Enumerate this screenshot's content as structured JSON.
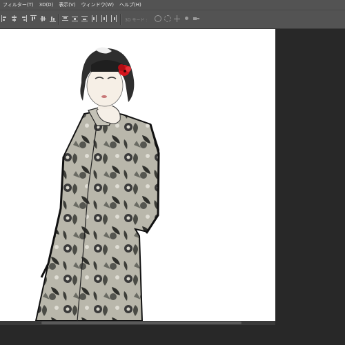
{
  "menu": {
    "items": [
      {
        "label": "フィルター(T)"
      },
      {
        "label": "3D(D)"
      },
      {
        "label": "表示(V)"
      },
      {
        "label": "ウィンドウ(W)"
      },
      {
        "label": "ヘルプ(H)"
      }
    ]
  },
  "options_bar": {
    "mode_3d_label": "3D モード :",
    "align_icons": [
      "align-left-edges-icon",
      "align-horizontal-centers-icon",
      "align-right-edges-icon",
      "align-top-edges-icon",
      "align-vertical-centers-icon",
      "align-bottom-edges-icon"
    ],
    "distribute_icons": [
      "distribute-top-icon",
      "distribute-vcenter-icon",
      "distribute-bottom-icon",
      "distribute-left-icon",
      "distribute-hcenter-icon",
      "distribute-right-icon"
    ],
    "mode_3d_icons": [
      "orbit-3d-icon",
      "roll-3d-icon",
      "pan-3d-icon",
      "slide-3d-icon",
      "scale-3d-icon"
    ]
  },
  "canvas": {
    "background": "#ffffff",
    "artwork": "fashion-illustration"
  },
  "colors": {
    "menubar": "#535353",
    "workspace": "#282828",
    "hair_flower": "#d3141c"
  }
}
